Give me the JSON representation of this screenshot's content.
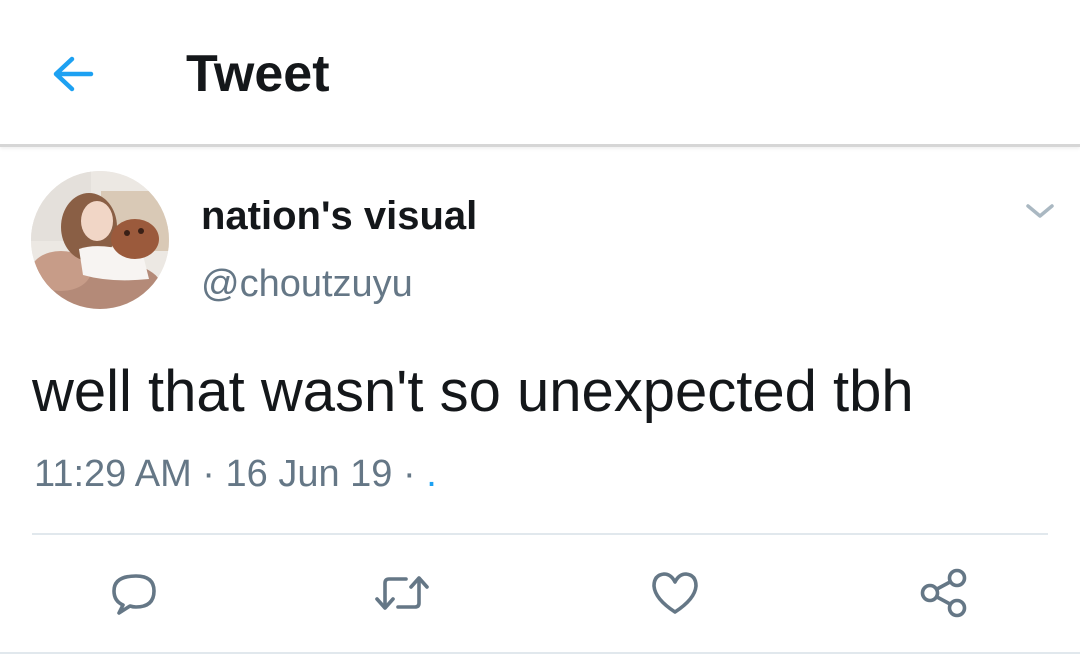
{
  "header": {
    "title": "Tweet",
    "back_icon": "arrow-left-icon"
  },
  "tweet": {
    "display_name": "nation's visual",
    "handle": "@choutzuyu",
    "text": "well that wasn't so unexpected tbh",
    "time": "11:29 AM",
    "date": "16 Jun 19",
    "separator": "·",
    "source_link": "."
  },
  "actions": [
    {
      "name": "reply",
      "icon": "reply-bubble-icon"
    },
    {
      "name": "retweet",
      "icon": "retweet-icon"
    },
    {
      "name": "like",
      "icon": "heart-icon"
    },
    {
      "name": "share",
      "icon": "share-icon"
    }
  ],
  "colors": {
    "accent": "#1da1f2",
    "text_primary": "#14171a",
    "text_secondary": "#657786",
    "divider": "#e1e8ed"
  }
}
